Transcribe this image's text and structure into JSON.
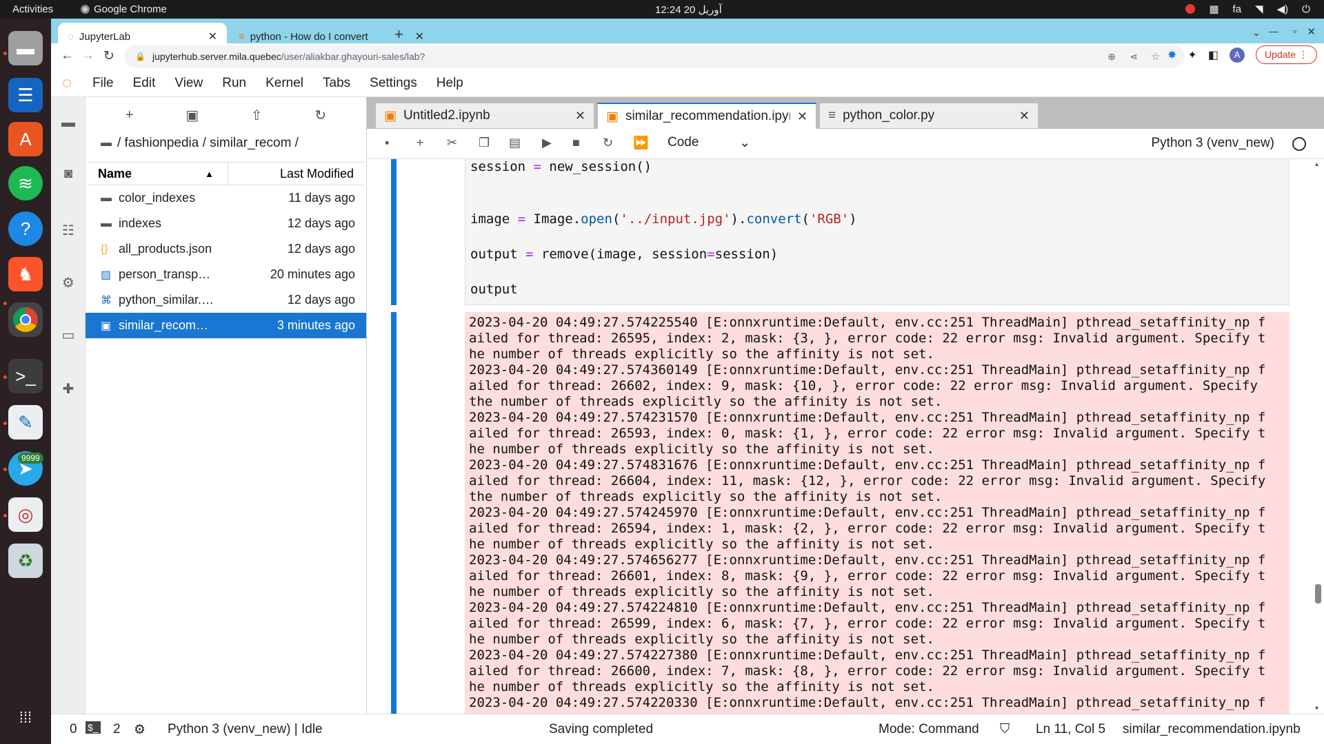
{
  "os_bar": {
    "activities": "Activities",
    "app_name": "Google Chrome",
    "clock": "12:24  20 آوریل",
    "lang": "fa"
  },
  "dock": {
    "telegram_badge": "9999",
    "items": [
      "files-icon",
      "text-editor-icon",
      "software-icon",
      "spotify-icon",
      "help-icon",
      "brave-icon",
      "chrome-icon",
      "terminal-icon",
      "writer-icon",
      "telegram-icon",
      "reader-icon",
      "trash-icon",
      "apps-grid-icon"
    ]
  },
  "browser": {
    "tabs": [
      {
        "label": "JupyterLab"
      },
      {
        "label": "python - How do I convert"
      }
    ],
    "url_host": "jupyterhub.server.mila.quebec",
    "url_path": "/user/aliakbar.ghayouri-sales/lab?",
    "update_label": "Update",
    "avatar_letter": "A"
  },
  "menu": [
    "File",
    "Edit",
    "View",
    "Run",
    "Kernel",
    "Tabs",
    "Settings",
    "Help"
  ],
  "filebrowser": {
    "breadcrumb": "/ fashionpedia / similar_recom /",
    "col_name": "Name",
    "col_modified": "Last Modified",
    "files": [
      {
        "name": "color_indexes",
        "modified": "11 days ago",
        "icon": "folder-icon"
      },
      {
        "name": "indexes",
        "modified": "12 days ago",
        "icon": "folder-icon"
      },
      {
        "name": "all_products.json",
        "modified": "12 days ago",
        "icon": "json-icon"
      },
      {
        "name": "person_transp…",
        "modified": "20 minutes ago",
        "icon": "image-icon"
      },
      {
        "name": "python_similar.…",
        "modified": "12 days ago",
        "icon": "python-icon"
      },
      {
        "name": "similar_recom…",
        "modified": "3 minutes ago",
        "icon": "notebook-icon"
      }
    ]
  },
  "doc_tabs": [
    {
      "label": "Untitled2.ipynb"
    },
    {
      "label": "similar_recommendation.ipyı"
    },
    {
      "label": "python_color.py"
    }
  ],
  "notebook_toolbar": {
    "cell_type": "Code",
    "kernel": "Python 3 (venv_new)"
  },
  "code_cell": {
    "l1_a": "session",
    "l1_b": " = ",
    "l1_c": "new_session()",
    "l2_a": "image",
    "l2_b": " = ",
    "l2_c": "Image.",
    "l2_d": "open",
    "l2_e": "(",
    "l2_f": "'../input.jpg'",
    "l2_g": ").",
    "l2_h": "convert",
    "l2_i": "(",
    "l2_j": "'RGB'",
    "l2_k": ")",
    "l3_a": "output",
    "l3_b": " = ",
    "l3_c": "remove(image, session",
    "l3_d": "=",
    "l3_e": "session)",
    "l4": "output"
  },
  "output_lines": [
    "2023-04-20 04:49:27.574225540 [E:onnxruntime:Default, env.cc:251 ThreadMain] pthread_setaffinity_np f",
    "ailed for thread: 26595, index: 2, mask: {3, }, error code: 22 error msg: Invalid argument. Specify t",
    "he number of threads explicitly so the affinity is not set.",
    "2023-04-20 04:49:27.574360149 [E:onnxruntime:Default, env.cc:251 ThreadMain] pthread_setaffinity_np f",
    "ailed for thread: 26602, index: 9, mask: {10, }, error code: 22 error msg: Invalid argument. Specify",
    "the number of threads explicitly so the affinity is not set.",
    "2023-04-20 04:49:27.574231570 [E:onnxruntime:Default, env.cc:251 ThreadMain] pthread_setaffinity_np f",
    "ailed for thread: 26593, index: 0, mask: {1, }, error code: 22 error msg: Invalid argument. Specify t",
    "he number of threads explicitly so the affinity is not set.",
    "2023-04-20 04:49:27.574831676 [E:onnxruntime:Default, env.cc:251 ThreadMain] pthread_setaffinity_np f",
    "ailed for thread: 26604, index: 11, mask: {12, }, error code: 22 error msg: Invalid argument. Specify",
    "the number of threads explicitly so the affinity is not set.",
    "2023-04-20 04:49:27.574245970 [E:onnxruntime:Default, env.cc:251 ThreadMain] pthread_setaffinity_np f",
    "ailed for thread: 26594, index: 1, mask: {2, }, error code: 22 error msg: Invalid argument. Specify t",
    "he number of threads explicitly so the affinity is not set.",
    "2023-04-20 04:49:27.574656277 [E:onnxruntime:Default, env.cc:251 ThreadMain] pthread_setaffinity_np f",
    "ailed for thread: 26601, index: 8, mask: {9, }, error code: 22 error msg: Invalid argument. Specify t",
    "he number of threads explicitly so the affinity is not set.",
    "2023-04-20 04:49:27.574224810 [E:onnxruntime:Default, env.cc:251 ThreadMain] pthread_setaffinity_np f",
    "ailed for thread: 26599, index: 6, mask: {7, }, error code: 22 error msg: Invalid argument. Specify t",
    "he number of threads explicitly so the affinity is not set.",
    "2023-04-20 04:49:27.574227380 [E:onnxruntime:Default, env.cc:251 ThreadMain] pthread_setaffinity_np f",
    "ailed for thread: 26600, index: 7, mask: {8, }, error code: 22 error msg: Invalid argument. Specify t",
    "he number of threads explicitly so the affinity is not set.",
    "2023-04-20 04:49:27.574220330 [E:onnxruntime:Default, env.cc:251 ThreadMain] pthread_setaffinity_np f"
  ],
  "statusbar": {
    "terminals": "0",
    "kernels": "2",
    "kernel_status": "Python 3 (venv_new) | Idle",
    "message": "Saving completed",
    "mode": "Mode: Command",
    "position": "Ln 11, Col 5",
    "filename": "similar_recommendation.ipynb"
  },
  "colors": {
    "accent": "#1976d2",
    "output_bg": "#ffdddd",
    "jupyter_orange": "#f37726"
  }
}
